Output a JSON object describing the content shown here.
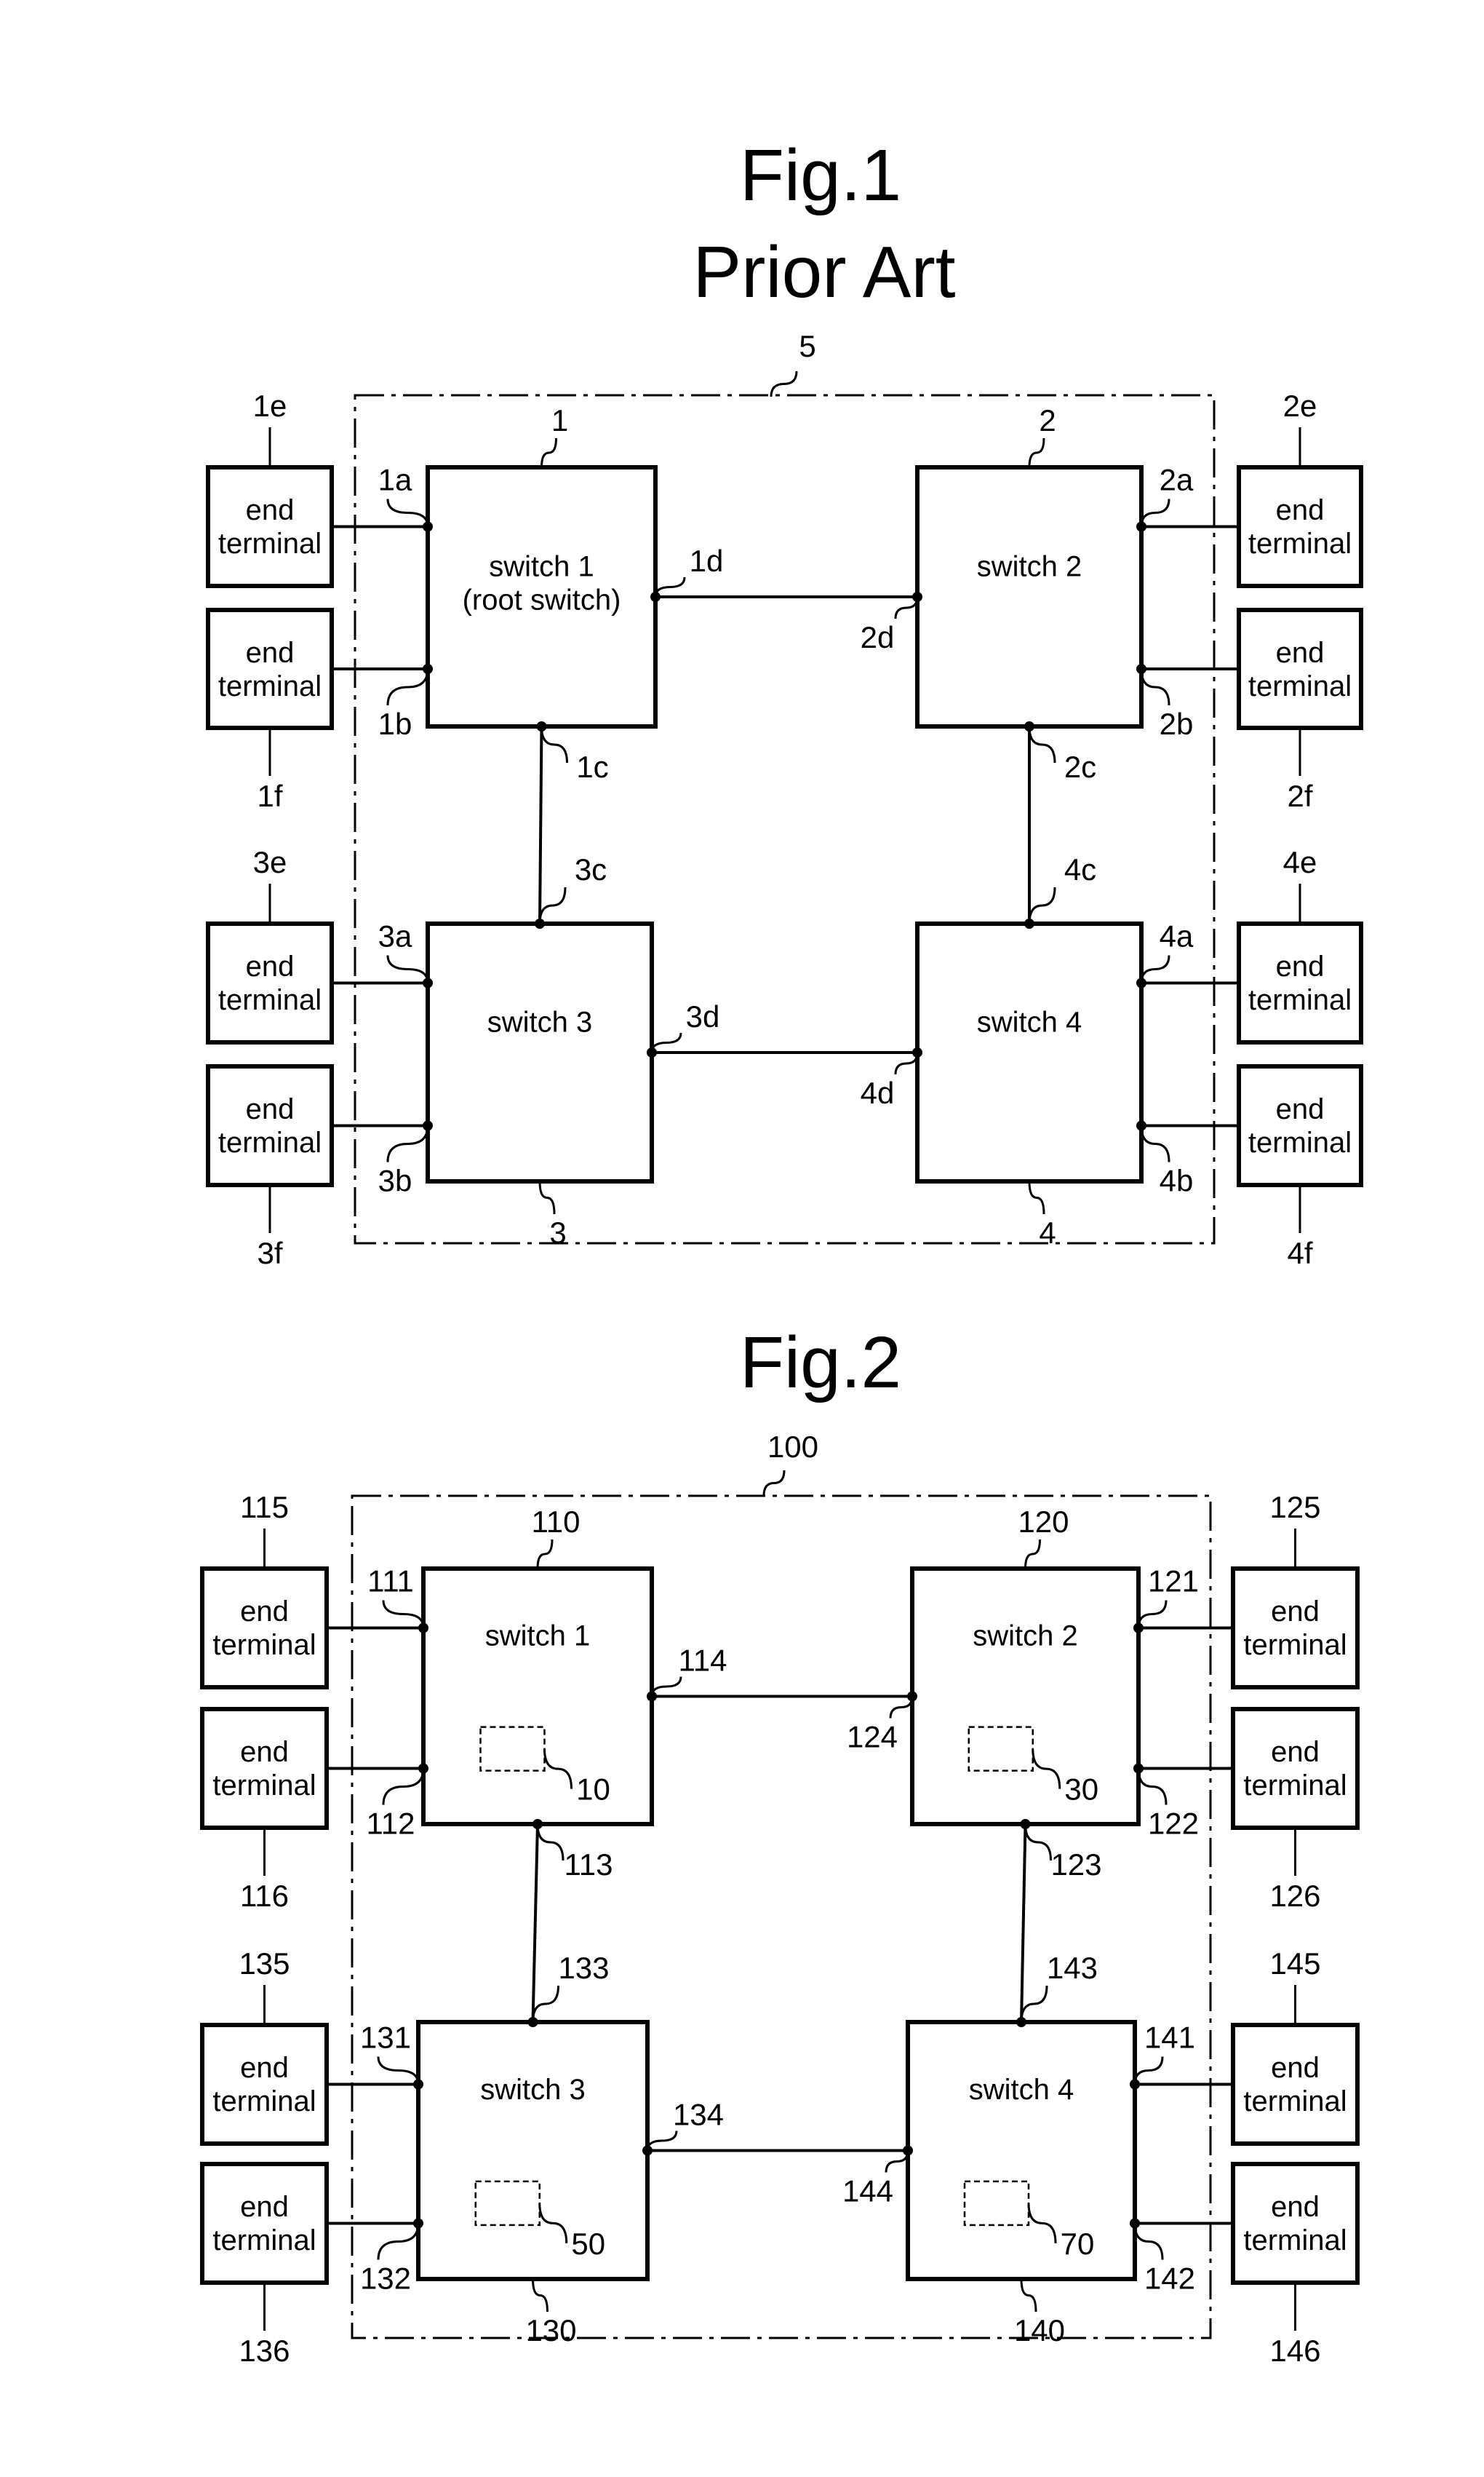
{
  "fig1": {
    "title": "Fig.1",
    "subtitle": "Prior Art",
    "network_ref": "5",
    "switches": [
      {
        "ref": "1",
        "label_lines": [
          "switch 1",
          "(root switch)"
        ],
        "ports": {
          "a": "1a",
          "b": "1b",
          "c": "1c",
          "d": "1d"
        },
        "terminals": [
          {
            "ref": "1e",
            "label_lines": [
              "end",
              "terminal"
            ]
          },
          {
            "ref": "1f",
            "label_lines": [
              "end",
              "terminal"
            ]
          }
        ]
      },
      {
        "ref": "2",
        "label_lines": [
          "switch 2"
        ],
        "ports": {
          "a": "2a",
          "b": "2b",
          "c": "2c",
          "d": "2d"
        },
        "terminals": [
          {
            "ref": "2e",
            "label_lines": [
              "end",
              "terminal"
            ]
          },
          {
            "ref": "2f",
            "label_lines": [
              "end",
              "terminal"
            ]
          }
        ]
      },
      {
        "ref": "3",
        "label_lines": [
          "switch 3"
        ],
        "ports": {
          "a": "3a",
          "b": "3b",
          "c": "3c",
          "d": "3d"
        },
        "terminals": [
          {
            "ref": "3e",
            "label_lines": [
              "end",
              "terminal"
            ]
          },
          {
            "ref": "3f",
            "label_lines": [
              "end",
              "terminal"
            ]
          }
        ]
      },
      {
        "ref": "4",
        "label_lines": [
          "switch 4"
        ],
        "ports": {
          "a": "4a",
          "b": "4b",
          "c": "4c",
          "d": "4d"
        },
        "terminals": [
          {
            "ref": "4e",
            "label_lines": [
              "end",
              "terminal"
            ]
          },
          {
            "ref": "4f",
            "label_lines": [
              "end",
              "terminal"
            ]
          }
        ]
      }
    ]
  },
  "fig2": {
    "title": "Fig.2",
    "network_ref": "100",
    "switches": [
      {
        "ref": "110",
        "label_lines": [
          "switch 1"
        ],
        "module_ref": "10",
        "ports": {
          "a": "111",
          "b": "112",
          "c": "113",
          "d": "114"
        },
        "terminals": [
          {
            "ref": "115",
            "label_lines": [
              "end",
              "terminal"
            ]
          },
          {
            "ref": "116",
            "label_lines": [
              "end",
              "terminal"
            ]
          }
        ]
      },
      {
        "ref": "120",
        "label_lines": [
          "switch 2"
        ],
        "module_ref": "30",
        "ports": {
          "a": "121",
          "b": "122",
          "c": "123",
          "d": "124"
        },
        "terminals": [
          {
            "ref": "125",
            "label_lines": [
              "end",
              "terminal"
            ]
          },
          {
            "ref": "126",
            "label_lines": [
              "end",
              "terminal"
            ]
          }
        ]
      },
      {
        "ref": "130",
        "label_lines": [
          "switch 3"
        ],
        "module_ref": "50",
        "ports": {
          "a": "131",
          "b": "132",
          "c": "133",
          "d": "134"
        },
        "terminals": [
          {
            "ref": "135",
            "label_lines": [
              "end",
              "terminal"
            ]
          },
          {
            "ref": "136",
            "label_lines": [
              "end",
              "terminal"
            ]
          }
        ]
      },
      {
        "ref": "140",
        "label_lines": [
          "switch 4"
        ],
        "module_ref": "70",
        "ports": {
          "a": "141",
          "b": "142",
          "c": "143",
          "d": "144"
        },
        "terminals": [
          {
            "ref": "145",
            "label_lines": [
              "end",
              "terminal"
            ]
          },
          {
            "ref": "146",
            "label_lines": [
              "end",
              "terminal"
            ]
          }
        ]
      }
    ]
  }
}
